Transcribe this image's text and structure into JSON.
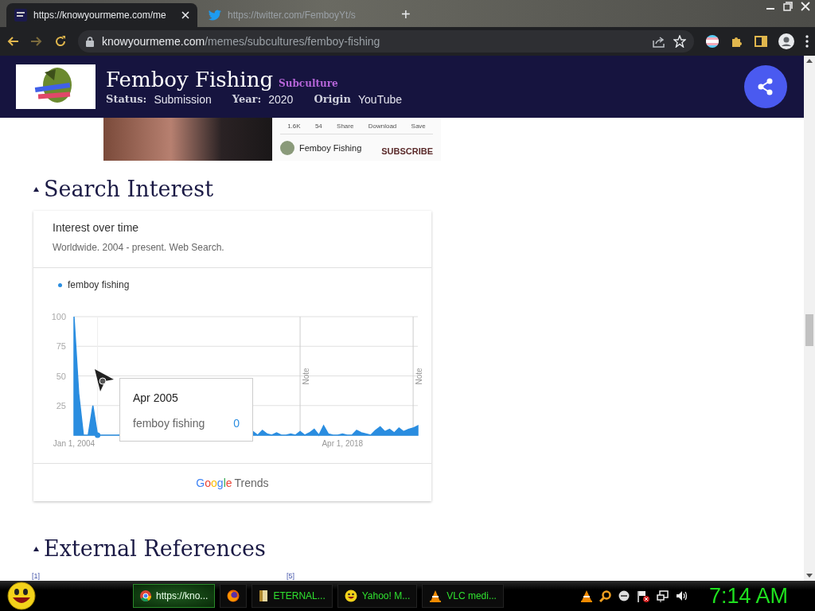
{
  "browser": {
    "tabs": [
      {
        "title": "https://knowyourmeme.com/me",
        "kind": "kym",
        "selected": true
      },
      {
        "title": "https://twitter.com/FemboyYt/s",
        "kind": "twitter",
        "selected": false
      }
    ],
    "new_tab": "+",
    "address": {
      "domain": "knowyourmeme.com",
      "path": "/memes/subcultures/femboy-fishing"
    }
  },
  "header": {
    "title": "Femboy Fishing",
    "category": "Subculture",
    "fields": [
      {
        "label": "Status:",
        "value": "Submission"
      },
      {
        "label": "Year:",
        "value": "2020"
      },
      {
        "label": "Origin",
        "value": "YouTube"
      }
    ]
  },
  "video": {
    "stats": [
      "1.6K",
      "54",
      "Share",
      "Download",
      "Save"
    ],
    "channel": "Femboy Fishing",
    "subscribe": "SUBSCRIBE"
  },
  "search_interest": {
    "heading": "Search Interest",
    "card": {
      "title": "Interest over time",
      "subtitle": "Worldwide. 2004 - present. Web Search.",
      "chart_data": {
        "type": "area",
        "categories": [
          "Jan 1, 2004",
          null,
          null,
          null,
          null,
          null,
          null,
          null,
          null,
          null,
          null,
          null,
          null,
          null,
          null,
          null,
          null,
          null,
          null,
          null,
          null,
          null,
          null,
          null,
          null,
          null,
          null,
          null,
          null,
          null,
          null,
          null,
          null,
          null,
          null,
          null,
          null,
          null,
          null,
          null,
          null,
          null,
          null,
          null,
          null,
          null,
          null,
          null,
          null,
          null,
          null,
          null,
          null,
          null,
          null,
          null,
          null,
          "Apr 1, 2018",
          null,
          null,
          null,
          null,
          null,
          null,
          null,
          null,
          null,
          null,
          null,
          null,
          null,
          null,
          null,
          null
        ],
        "series": [
          {
            "name": "femboy fishing",
            "color": "#2a8de0",
            "values": [
              100,
              35,
              0,
              0,
              25,
              0,
              0,
              0,
              0,
              0,
              null,
              null,
              null,
              null,
              null,
              null,
              null,
              null,
              null,
              null,
              null,
              null,
              null,
              null,
              null,
              null,
              null,
              null,
              null,
              null,
              null,
              null,
              null,
              null,
              null,
              null,
              null,
              null,
              3,
              0,
              4,
              1,
              0,
              2,
              0,
              0,
              1,
              0,
              3,
              0,
              2,
              5,
              0,
              8,
              1,
              0,
              0,
              1,
              0,
              0,
              4,
              2,
              1,
              0,
              4,
              7,
              3,
              5,
              2,
              6,
              3,
              5,
              6,
              8
            ]
          }
        ],
        "ylim": [
          0,
          100
        ],
        "yticks": [
          25,
          50,
          75,
          100
        ],
        "grid": true,
        "annotations": [
          "Note",
          "Note"
        ]
      },
      "tooltip": {
        "date": "Apr 2005",
        "term": "femboy fishing",
        "value": "0"
      },
      "footer": {
        "brand": "Google",
        "product": "Trends"
      }
    }
  },
  "external_references": {
    "heading": "External References",
    "refs": [
      "[1]",
      "[5]"
    ]
  },
  "taskbar": {
    "tasks": [
      {
        "kind": "chrome",
        "label": "https://kno...",
        "selected": true
      },
      {
        "kind": "firefox",
        "selected": false
      },
      {
        "kind": "folder",
        "label": "ETERNAL...",
        "selected": false
      },
      {
        "kind": "yahoo",
        "label": "Yahoo! M...",
        "selected": false
      },
      {
        "kind": "vlc",
        "label": "VLC medi...",
        "selected": false
      }
    ],
    "clock": "7:14 AM"
  }
}
